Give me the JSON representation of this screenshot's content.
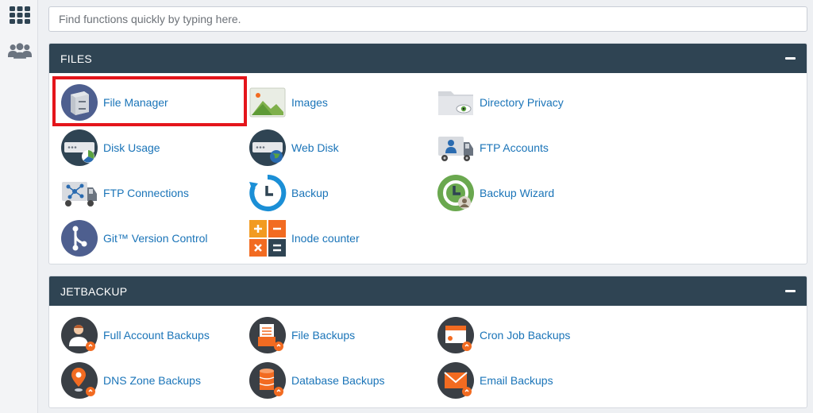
{
  "search": {
    "placeholder": "Find functions quickly by typing here."
  },
  "sidebar": {
    "items": [
      {
        "icon": "grid-icon",
        "name": "apps"
      },
      {
        "icon": "users-icon",
        "name": "users"
      }
    ]
  },
  "files": {
    "title": "FILES",
    "items": [
      {
        "label": "File Manager",
        "icon": "file-manager-icon",
        "highlighted": true
      },
      {
        "label": "Images",
        "icon": "images-icon"
      },
      {
        "label": "Directory Privacy",
        "icon": "directory-privacy-icon"
      },
      {
        "label": "Disk Usage",
        "icon": "disk-usage-icon"
      },
      {
        "label": "Web Disk",
        "icon": "web-disk-icon"
      },
      {
        "label": "FTP Accounts",
        "icon": "ftp-accounts-icon"
      },
      {
        "label": "FTP Connections",
        "icon": "ftp-connections-icon"
      },
      {
        "label": "Backup",
        "icon": "backup-icon"
      },
      {
        "label": "Backup Wizard",
        "icon": "backup-wizard-icon"
      },
      {
        "label": "Git™ Version Control",
        "icon": "git-icon"
      },
      {
        "label": "Inode counter",
        "icon": "inode-counter-icon"
      }
    ]
  },
  "jetbackup": {
    "title": "JETBACKUP",
    "items": [
      {
        "label": "Full Account Backups",
        "icon": "full-account-backups-icon"
      },
      {
        "label": "File Backups",
        "icon": "file-backups-icon"
      },
      {
        "label": "Cron Job Backups",
        "icon": "cron-job-backups-icon"
      },
      {
        "label": "DNS Zone Backups",
        "icon": "dns-zone-backups-icon"
      },
      {
        "label": "Database Backups",
        "icon": "database-backups-icon"
      },
      {
        "label": "Email Backups",
        "icon": "email-backups-icon"
      }
    ]
  },
  "colors": {
    "header": "#2f4453",
    "link": "#1a74b8",
    "highlight": "#e4151b",
    "accent": "#f26b21"
  }
}
